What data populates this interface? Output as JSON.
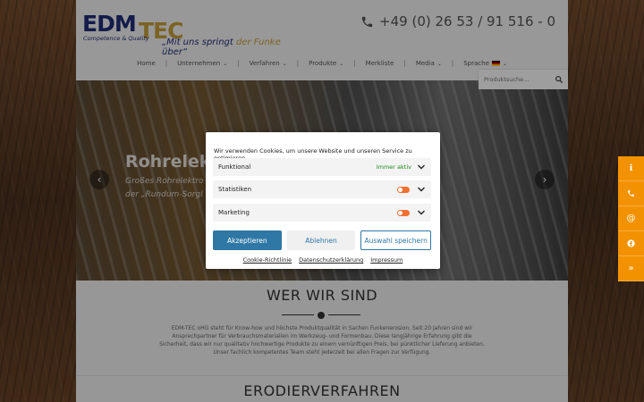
{
  "header": {
    "logo_main": "EDM",
    "logo_tec": "TEC",
    "logo_sub": "Competence & Quality",
    "slogan_a": "„Mit uns springt ",
    "slogan_b": "der Funke",
    "slogan_c": " über“",
    "phone": "+49 (0) 26 53 / 91 516 - 0"
  },
  "nav": {
    "items": [
      {
        "label": "Home"
      },
      {
        "label": "Unternehmen"
      },
      {
        "label": "Verfahren"
      },
      {
        "label": "Produkte"
      },
      {
        "label": "Merkliste"
      },
      {
        "label": "Media"
      },
      {
        "label": "Sprache"
      }
    ]
  },
  "search": {
    "placeholder": "Produktsuche..."
  },
  "hero": {
    "title": "Rohrelek",
    "line1": "Großes Rohrelektro",
    "line2": "der „Rundum-Sorgl"
  },
  "about": {
    "heading": "WER WIR SIND",
    "text": "EDM-TEC oHG steht für Know-how und höchste Produktqualität in Sachen Funkenerosion. Seit 20 Jahren sind wir Ansprechpartner für Verbrauchsmaterialien im Werkzeug- und Formenbau. Diese langjährige Erfahrung gibt die Sicherheit, dass wir nur qualitativ hochwertige Produkte zu einem vernünftigen Preis, bei pünktlicher Lieferung anbieten. Unser fachlich kompetentes Team steht jederzeit bei allen Fragen zur Verfügung."
  },
  "section2": {
    "heading": "ERODIERVERFAHREN"
  },
  "cookie": {
    "intro": "Wir verwenden Cookies, um unsere Website und unseren Service zu optimieren.",
    "rows": [
      {
        "label": "Funktional",
        "status": "Immer aktiv"
      },
      {
        "label": "Statistiken"
      },
      {
        "label": "Marketing"
      }
    ],
    "accept": "Akzeptieren",
    "deny": "Ablehnen",
    "save": "Auswahl speichern",
    "links": [
      "Cookie-Richtlinie",
      "Datenschutzerklärung",
      "Impressum"
    ]
  },
  "side": {
    "icons": [
      "info-icon",
      "phone-icon",
      "at-icon",
      "facebook-icon",
      "scroll-top-icon"
    ]
  },
  "colors": {
    "accent": "#f39200",
    "brand_blue": "#1f2e7a",
    "button_blue": "#2f78a5"
  }
}
